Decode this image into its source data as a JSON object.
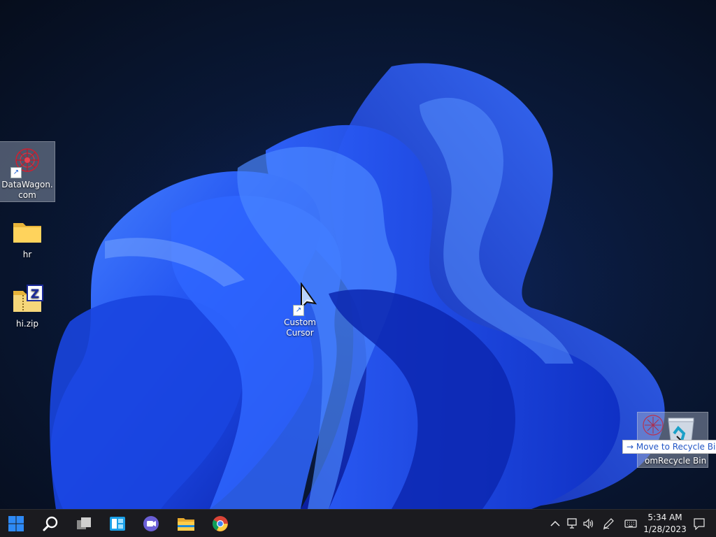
{
  "desktop": {
    "icons": [
      {
        "label": "DataWagon.com",
        "icon": "datawagon-logo-icon",
        "shortcut": true,
        "selected": true
      },
      {
        "label": "hr",
        "icon": "folder-icon",
        "shortcut": false,
        "selected": false
      },
      {
        "label": "hi.zip",
        "icon": "zip-folder-icon",
        "shortcut": false,
        "selected": false
      },
      {
        "label": "Custom Cursor",
        "icon": "cursor-shortcut-icon",
        "shortcut": true,
        "selected": false
      }
    ],
    "drag": {
      "tooltip": "→ Move to Recycle Bin",
      "ghost_label": "omRecycle Bin"
    }
  },
  "taskbar": {
    "apps": [
      "windows-start-icon",
      "search-icon",
      "task-view-icon",
      "widgets-icon",
      "chat-icon",
      "file-explorer-icon",
      "chrome-icon"
    ],
    "tray": [
      "chevron-up-icon",
      "network-icon",
      "volume-icon",
      "pen-icon",
      "keyboard-icon",
      "notification-icon"
    ],
    "clock": {
      "time": "5:34 AM",
      "date": "1/28/2023"
    }
  },
  "colors": {
    "wallpaper_bg": "#08142c",
    "bloom": "#1f4ff0",
    "taskbar": "#1b1b1f",
    "tooltip_text": "#2256c6"
  }
}
